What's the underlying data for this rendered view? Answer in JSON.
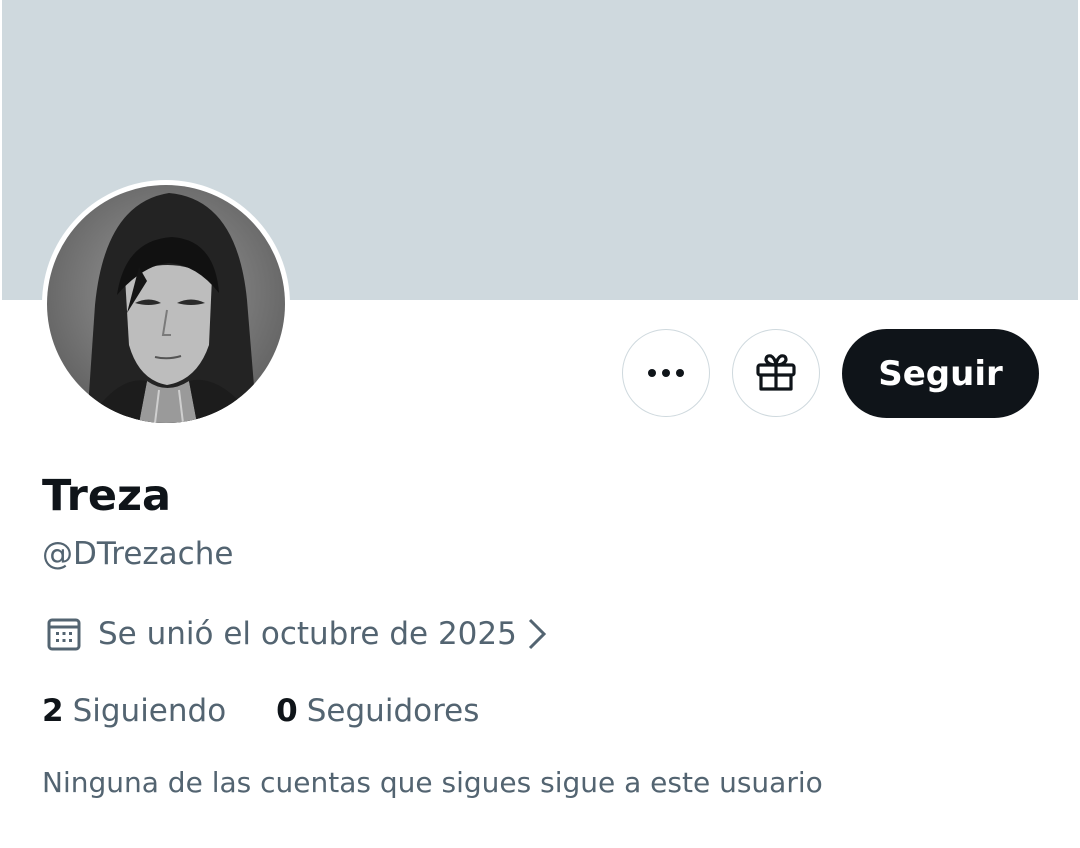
{
  "profile": {
    "display_name": "Treza",
    "handle": "@DTrezache",
    "joined": "Se unió el octubre de 2025",
    "following_count": "2",
    "following_label": "Siguiendo",
    "followers_count": "0",
    "followers_label": "Seguidores",
    "mutuals_note": "Ninguna de las cuentas que sigues sigue a este usuario"
  },
  "actions": {
    "follow_label": "Seguir",
    "more_icon": "more-horizontal-icon",
    "gift_icon": "gift-icon"
  },
  "colors": {
    "banner": "#cfd9de",
    "primary_text": "#0f1419",
    "secondary_text": "#536471",
    "button_dark": "#0f1419",
    "border": "#cfd9de"
  }
}
